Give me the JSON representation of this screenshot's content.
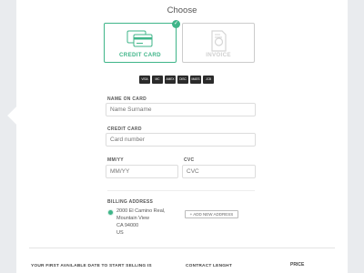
{
  "header": {
    "title": "Choose"
  },
  "payment_options": [
    {
      "label": "CREDIT CARD",
      "icon": "credit-card-icon",
      "selected": true
    },
    {
      "label": "INVOICE",
      "icon": "invoice-icon",
      "selected": false
    }
  ],
  "card_brands": [
    "VISA",
    "MC",
    "AMEX",
    "DISC",
    "MAES",
    "JCB"
  ],
  "form": {
    "name_on_card": {
      "label": "NAME ON CARD",
      "placeholder": "Name Surname"
    },
    "credit_card": {
      "label": "CREDIT CARD",
      "placeholder": "Card number"
    },
    "expiry": {
      "label": "MM/YY",
      "placeholder": "MM/YY"
    },
    "cvc": {
      "label": "CVC",
      "placeholder": "CVC"
    }
  },
  "billing": {
    "label": "BILLING ADDRESS",
    "address_lines": [
      "2000 El Camino Real,",
      "Mountain View",
      "CA 94000",
      "US"
    ],
    "add_button": "+ ADD NEW ADDRESS"
  },
  "bottom": {
    "first_date_label": "YOUR FIRST AVAILABLE DATE TO START SELLING IS",
    "contract_label": "CONTRACT LENGHT",
    "price_label": "PRICE"
  },
  "colors": {
    "accent": "#3fb589",
    "background": "#e9ebee"
  }
}
